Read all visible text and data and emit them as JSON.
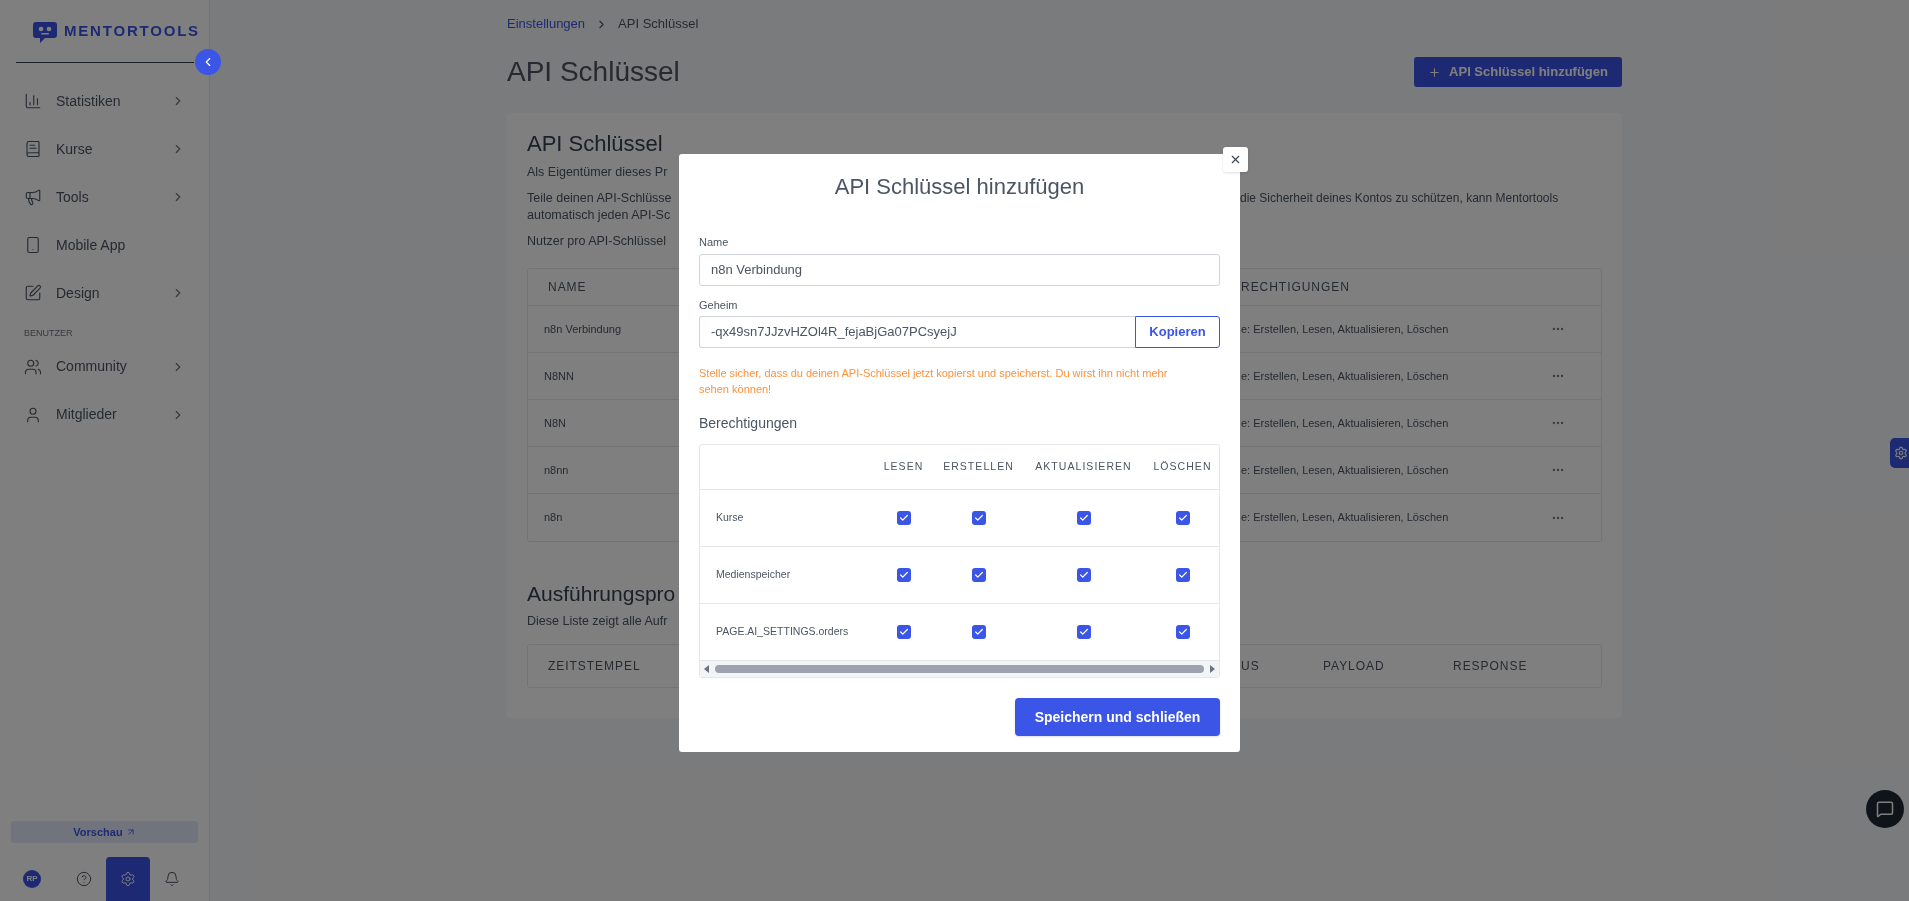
{
  "sidebar": {
    "logo": "MENTORTOOLS",
    "nav": [
      {
        "label": "Statistiken",
        "expandable": true
      },
      {
        "label": "Kurse",
        "expandable": true
      },
      {
        "label": "Tools",
        "expandable": true
      },
      {
        "label": "Mobile App",
        "expandable": false
      },
      {
        "label": "Design",
        "expandable": true
      }
    ],
    "section_label": "BENUTZER",
    "nav_users": [
      {
        "label": "Community",
        "expandable": true
      },
      {
        "label": "Mitglieder",
        "expandable": true
      }
    ],
    "preview_button": "Vorschau",
    "avatar": "RP",
    "bottom_icons": [
      {
        "selected": false
      },
      {
        "selected": true
      },
      {
        "selected": false
      }
    ]
  },
  "breadcrumb": [
    "Einstellungen",
    "API Schlüssel"
  ],
  "page_title": "API Schlüssel",
  "add_button": "API Schlüssel hinzufügen",
  "card": {
    "title": "API Schlüssel",
    "lines": [
      {
        "left": "Als Eigentümer dieses Pr"
      },
      {
        "left": "Teile deinen API-Schlüsse",
        "right": "die Sicherheit deines Kontos zu schützen, kann Mentortools"
      },
      {
        "left": "automatisch jeden API-Sc"
      },
      {
        "left": "Nutzer pro API-Schlüssel"
      }
    ],
    "table": {
      "header_left": "NAME",
      "header_right": "RECHTIGUNGEN",
      "rows": [
        {
          "name": "n8n Verbindung",
          "permissions": "e: Erstellen, Lesen, Aktualisieren, Löschen"
        },
        {
          "name": "N8NN",
          "permissions": "e: Erstellen, Lesen, Aktualisieren, Löschen"
        },
        {
          "name": "N8N",
          "permissions": "e: Erstellen, Lesen, Aktualisieren, Löschen"
        },
        {
          "name": "n8nn",
          "permissions": "e: Erstellen, Lesen, Aktualisieren, Löschen"
        },
        {
          "name": "n8n",
          "permissions": "e: Erstellen, Lesen, Aktualisieren, Löschen"
        }
      ]
    },
    "log_title": "Ausführungspro",
    "log_text": "Diese Liste zeigt alle Aufr",
    "log_table": {
      "header_left": "ZEITSTEMPEL",
      "header_right": [
        "US",
        "PAYLOAD",
        "RESPONSE"
      ]
    }
  },
  "modal": {
    "title": "API Schlüssel hinzufügen",
    "name_label": "Name",
    "name_value": "n8n Verbindung",
    "secret_label": "Geheim",
    "secret_value": "-qx49sn7JJzvHZOl4R_fejaBjGa07PCsyejJ",
    "copy_button": "Kopieren",
    "warning": "Stelle sicher, dass du deinen API-Schlüssel jetzt kopierst und speicherst. Du wirst ihn nicht mehr sehen können!",
    "permissions_title": "Berechtigungen",
    "columns": [
      "LESEN",
      "ERSTELLEN",
      "AKTUALISIEREN",
      "LÖSCHEN"
    ],
    "rows": [
      {
        "name": "Kurse",
        "checked": [
          true,
          true,
          true,
          true
        ]
      },
      {
        "name": "Medienspeicher",
        "checked": [
          true,
          true,
          true,
          true
        ]
      },
      {
        "name": "PAGE.AI_SETTINGS.orders",
        "checked": [
          true,
          true,
          true,
          true
        ]
      }
    ],
    "save_button": "Speichern und schließen"
  }
}
